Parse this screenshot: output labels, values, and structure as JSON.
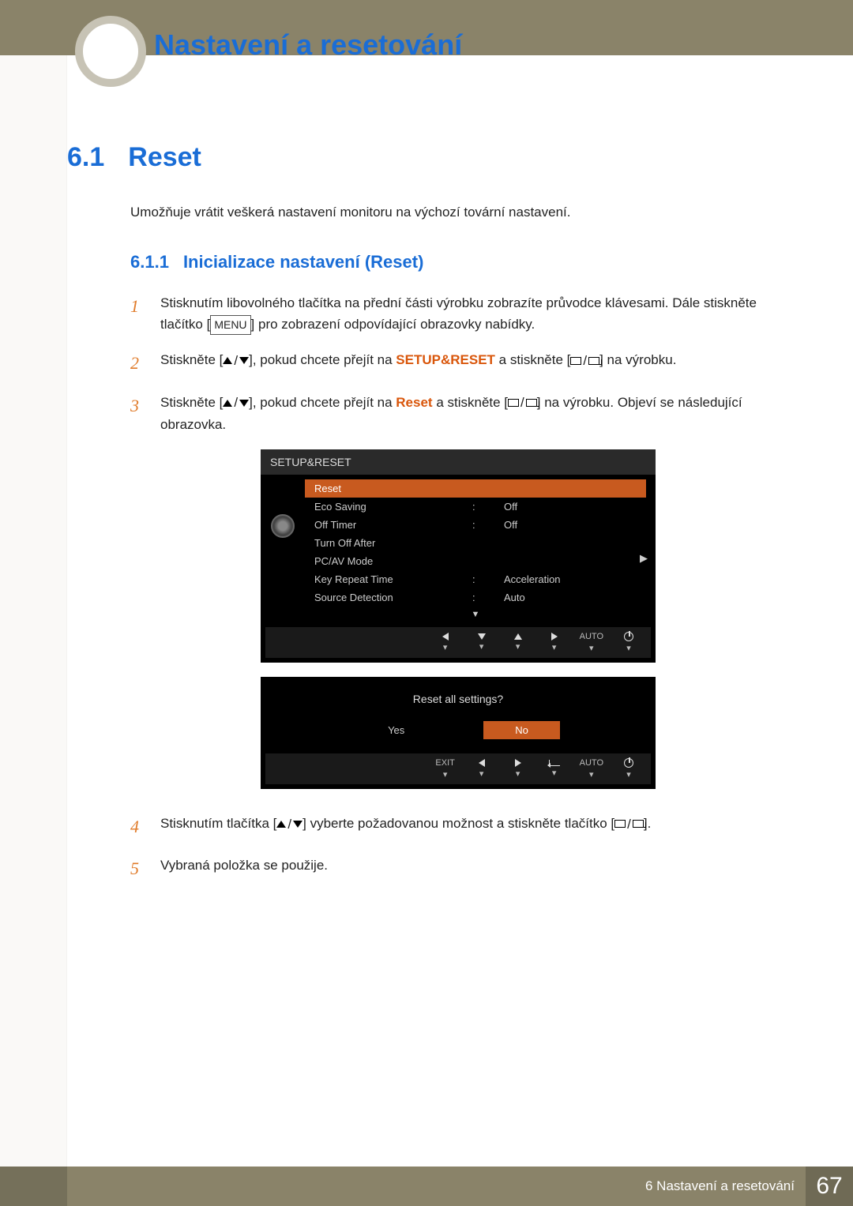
{
  "chapter_title": "Nastavení a resetování",
  "section": {
    "num": "6.1",
    "title": "Reset"
  },
  "intro": "Umožňuje vrátit veškerá nastavení monitoru na výchozí tovární nastavení.",
  "subsection": {
    "num": "6.1.1",
    "title": "Inicializace nastavení (Reset)"
  },
  "steps": {
    "s1": {
      "num": "1",
      "a": "Stisknutím libovolného tlačítka na přední části výrobku zobrazíte průvodce klávesami. Dále stiskněte tlačítko [",
      "menu": "MENU",
      "b": "] pro zobrazení odpovídající obrazovky nabídky."
    },
    "s2": {
      "num": "2",
      "a": "Stiskněte [",
      "b": "], pokud chcete přejít na ",
      "hl": "SETUP&RESET",
      "c": " a stiskněte [",
      "d": "] na výrobku."
    },
    "s3": {
      "num": "3",
      "a": "Stiskněte [",
      "b": "], pokud chcete přejít na ",
      "hl": "Reset",
      "c": " a stiskněte [",
      "d": "] na výrobku. Objeví se následující obrazovka."
    },
    "s4": {
      "num": "4",
      "a": "Stisknutím tlačítka [",
      "b": "] vyberte požadovanou možnost a stiskněte tlačítko [",
      "c": "]."
    },
    "s5": {
      "num": "5",
      "text": "Vybraná položka se použije."
    }
  },
  "osd": {
    "title": "SETUP&RESET",
    "rows": [
      {
        "label": "Reset",
        "value": "",
        "selected": true
      },
      {
        "label": "Eco Saving",
        "value": "Off"
      },
      {
        "label": "Off Timer",
        "value": "Off"
      },
      {
        "label": "Turn Off After",
        "value": ""
      },
      {
        "label": "PC/AV Mode",
        "value": ""
      },
      {
        "label": "Key Repeat Time",
        "value": "Acceleration"
      },
      {
        "label": "Source Detection",
        "value": "Auto"
      }
    ],
    "btnbar": {
      "auto": "AUTO"
    }
  },
  "osd2": {
    "question": "Reset all settings?",
    "yes": "Yes",
    "no": "No",
    "exit": "EXIT",
    "auto": "AUTO"
  },
  "footer": {
    "chapter": "6 Nastavení a resetování",
    "page": "67"
  }
}
